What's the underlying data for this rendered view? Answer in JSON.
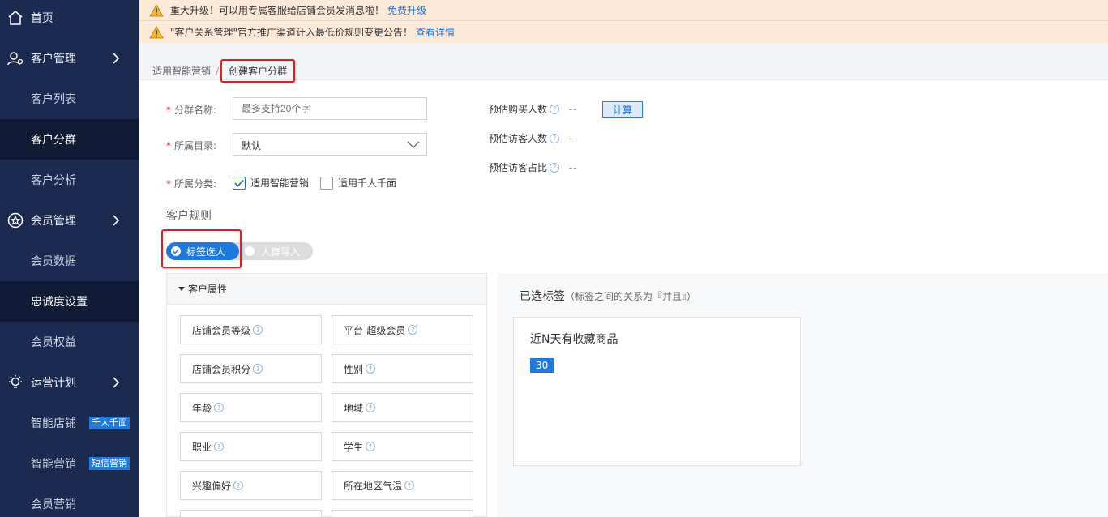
{
  "sidebar": {
    "items": [
      {
        "label": "首页",
        "icon": "home-icon",
        "type": "top"
      },
      {
        "label": "客户管理",
        "icon": "customers-icon",
        "type": "top",
        "arrow": true
      },
      {
        "label": "客户列表",
        "type": "sub"
      },
      {
        "label": "客户分群",
        "type": "sub",
        "active": true
      },
      {
        "label": "客户分析",
        "type": "sub"
      },
      {
        "label": "会员管理",
        "icon": "member-icon",
        "type": "top",
        "arrow": true
      },
      {
        "label": "会员数据",
        "type": "sub"
      },
      {
        "label": "忠诚度设置",
        "type": "sub",
        "active": true
      },
      {
        "label": "会员权益",
        "type": "sub"
      },
      {
        "label": "运营计划",
        "icon": "bulb-icon",
        "type": "top",
        "arrow": true
      },
      {
        "label": "智能店铺",
        "type": "sub",
        "badge": "千人千面"
      },
      {
        "label": "智能营销",
        "type": "sub",
        "badge": "短信营销"
      },
      {
        "label": "会员营销",
        "type": "sub"
      }
    ]
  },
  "notices": [
    {
      "text": "重大升级！可以用专属客服给店铺会员发消息啦！",
      "link": "免费升级"
    },
    {
      "text": "\"客户关系管理\"官方推广渠道计入最低价规则变更公告！",
      "link": "查看详情"
    }
  ],
  "breadcrumb": {
    "parent": "适用智能营销",
    "separator": "/",
    "current": "创建客户分群"
  },
  "form": {
    "required_mark": "*",
    "name_label": "分群名称:",
    "name_placeholder": "最多支持20个字",
    "dir_label": "所属目录:",
    "dir_value": "默认",
    "cat_label": "所属分类:",
    "cat_option1": "适用智能营销",
    "cat_option2": "适用千人千面"
  },
  "estimates": {
    "buyers_label": "预估购买人数",
    "visitors_label": "预估访客人数",
    "ratio_label": "预估访客占比",
    "buyers_value": "--",
    "visitors_value": "--",
    "ratio_value": "--",
    "calc_button": "计算",
    "help_glyph": "?"
  },
  "rules": {
    "title": "客户规则",
    "toggle_on": "标签选人",
    "toggle_off": "人群导入"
  },
  "attributes": {
    "header": "客户属性",
    "items": [
      {
        "label": "店铺会员等级"
      },
      {
        "label": "平台-超级会员"
      },
      {
        "label": "店铺会员积分"
      },
      {
        "label": "性别"
      },
      {
        "label": "年龄"
      },
      {
        "label": "地域"
      },
      {
        "label": "职业"
      },
      {
        "label": "学生"
      },
      {
        "label": "兴趣偏好"
      },
      {
        "label": "所在地区气温"
      }
    ]
  },
  "selected": {
    "title": "已选标签",
    "subtitle": "（标签之间的关系为『并且』）",
    "tag_name": "近N天有收藏商品",
    "tag_value": "30"
  },
  "colors": {
    "sidebar_bg": "#1a2b4f",
    "accent": "#1f7ae0",
    "notice_bg": "#fde9d8",
    "highlight": "#e02020"
  }
}
